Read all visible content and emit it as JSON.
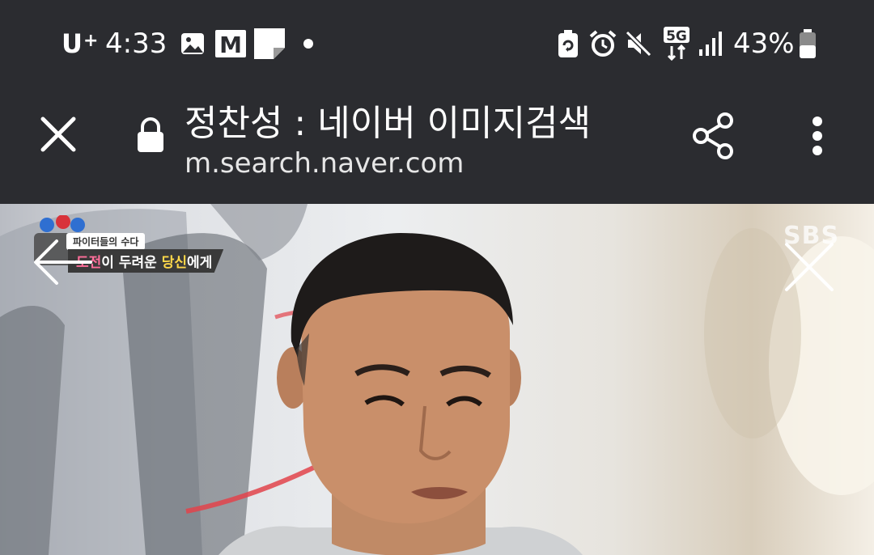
{
  "status_bar": {
    "carrier": "U",
    "carrier_sup": "+",
    "time": "4:33",
    "battery_percent": "43%",
    "network": "5G",
    "icons": [
      "photo-icon",
      "gmail-icon",
      "note-icon",
      "dot-icon",
      "battery-saver-icon",
      "alarm-icon",
      "mute-icon",
      "5g-icon",
      "signal-icon",
      "battery-icon"
    ]
  },
  "toolbar": {
    "title": "정찬성 : 네이버 이미지검색",
    "url": "m.search.naver.com",
    "icons": [
      "close-icon",
      "lock-icon",
      "share-icon",
      "more-icon"
    ]
  },
  "viewer": {
    "caption_top": "파이터들의 수다",
    "caption_words": [
      "도전",
      "이 두려운 ",
      "당신"
    ],
    "caption_tail": "에게",
    "watermark": "SBS",
    "icons": [
      "back-arrow-icon",
      "close-icon"
    ]
  },
  "colors": {
    "bar_bg": "#2b2c30",
    "text": "#ffffff",
    "accent_pink": "#ff6e9a",
    "accent_yellow": "#ffd84a"
  }
}
